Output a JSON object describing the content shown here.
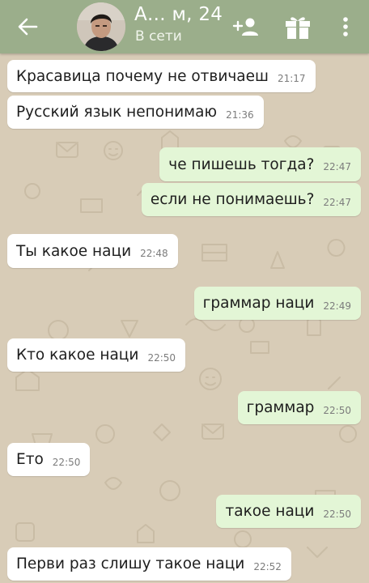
{
  "header": {
    "contact_name": "А...  м, 24",
    "status": "В сети",
    "bg_color": "#9bae8b",
    "icons": [
      "arrow-back-icon",
      "add-friend-icon",
      "gift-icon",
      "more-vert-icon"
    ]
  },
  "chat": {
    "messages": [
      {
        "direction": "incoming",
        "text": "Красавица почему не отвичаеш",
        "time": "21:17"
      },
      {
        "direction": "incoming",
        "text": "Русский язык непонимаю",
        "time": "21:36"
      },
      {
        "direction": "outgoing",
        "text": "че пишешь тогда?",
        "time": "22:47"
      },
      {
        "direction": "outgoing",
        "text": "если не понимаешь?",
        "time": "22:47"
      },
      {
        "direction": "incoming",
        "text": "Ты какое наци",
        "time": "22:48"
      },
      {
        "direction": "outgoing",
        "text": "граммар наци",
        "time": "22:49"
      },
      {
        "direction": "incoming",
        "text": "Кто какое наци",
        "time": "22:50"
      },
      {
        "direction": "outgoing",
        "text": "граммар",
        "time": "22:50"
      },
      {
        "direction": "incoming",
        "text": "Ето",
        "time": "22:50"
      },
      {
        "direction": "outgoing",
        "text": "такое наци",
        "time": "22:50"
      },
      {
        "direction": "incoming",
        "text": "Перви раз слишу такое наци",
        "time": "22:52"
      }
    ],
    "colors": {
      "incoming": "#ffffff",
      "outgoing": "#e3f6d6",
      "background": "#d8ccb7"
    }
  }
}
